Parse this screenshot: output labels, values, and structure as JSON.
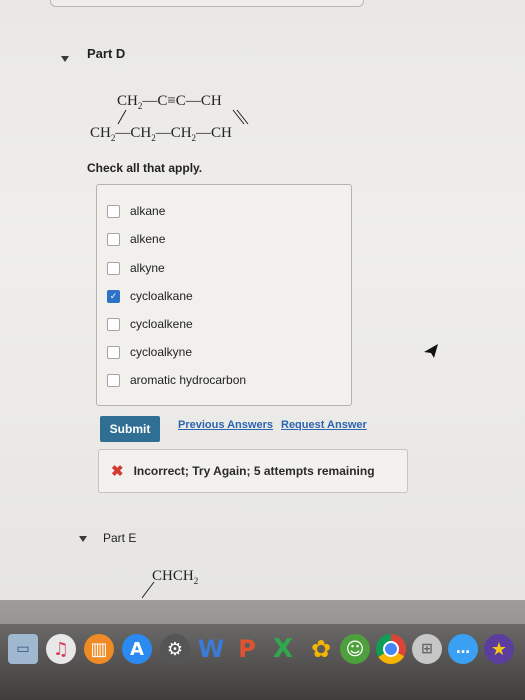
{
  "part_d": {
    "title": "Part D",
    "formula_line1": "CH2—C≡C—CH",
    "formula_line2": "CH2—CH2—CH2—CH",
    "instruction": "Check all that apply.",
    "options": [
      {
        "label": "alkane",
        "checked": false
      },
      {
        "label": "alkene",
        "checked": false
      },
      {
        "label": "alkyne",
        "checked": false
      },
      {
        "label": "cycloalkane",
        "checked": true
      },
      {
        "label": "cycloalkene",
        "checked": false
      },
      {
        "label": "cycloalkyne",
        "checked": false
      },
      {
        "label": "aromatic hydrocarbon",
        "checked": false
      }
    ],
    "submit_label": "Submit",
    "previous_answers_label": "Previous Answers",
    "request_answer_label": "Request Answer",
    "feedback_icon": "✖",
    "feedback_text": "Incorrect; Try Again; 5 attempts remaining"
  },
  "part_e": {
    "title": "Part E",
    "formula_partial": "CHCH2"
  },
  "dock": {
    "icons": [
      "terminal-icon",
      "music-icon",
      "books-icon",
      "app-store-icon",
      "system-preferences-icon",
      "word-icon",
      "powerpoint-icon",
      "excel-icon",
      "photos-icon",
      "contacts-icon",
      "chrome-icon",
      "launchpad-icon",
      "messages-icon",
      "imovie-icon"
    ]
  },
  "colors": {
    "submit": "#2f6f93",
    "link": "#2d64b2",
    "error": "#d43a2f",
    "checkbox_checked": "#2e74c6"
  }
}
